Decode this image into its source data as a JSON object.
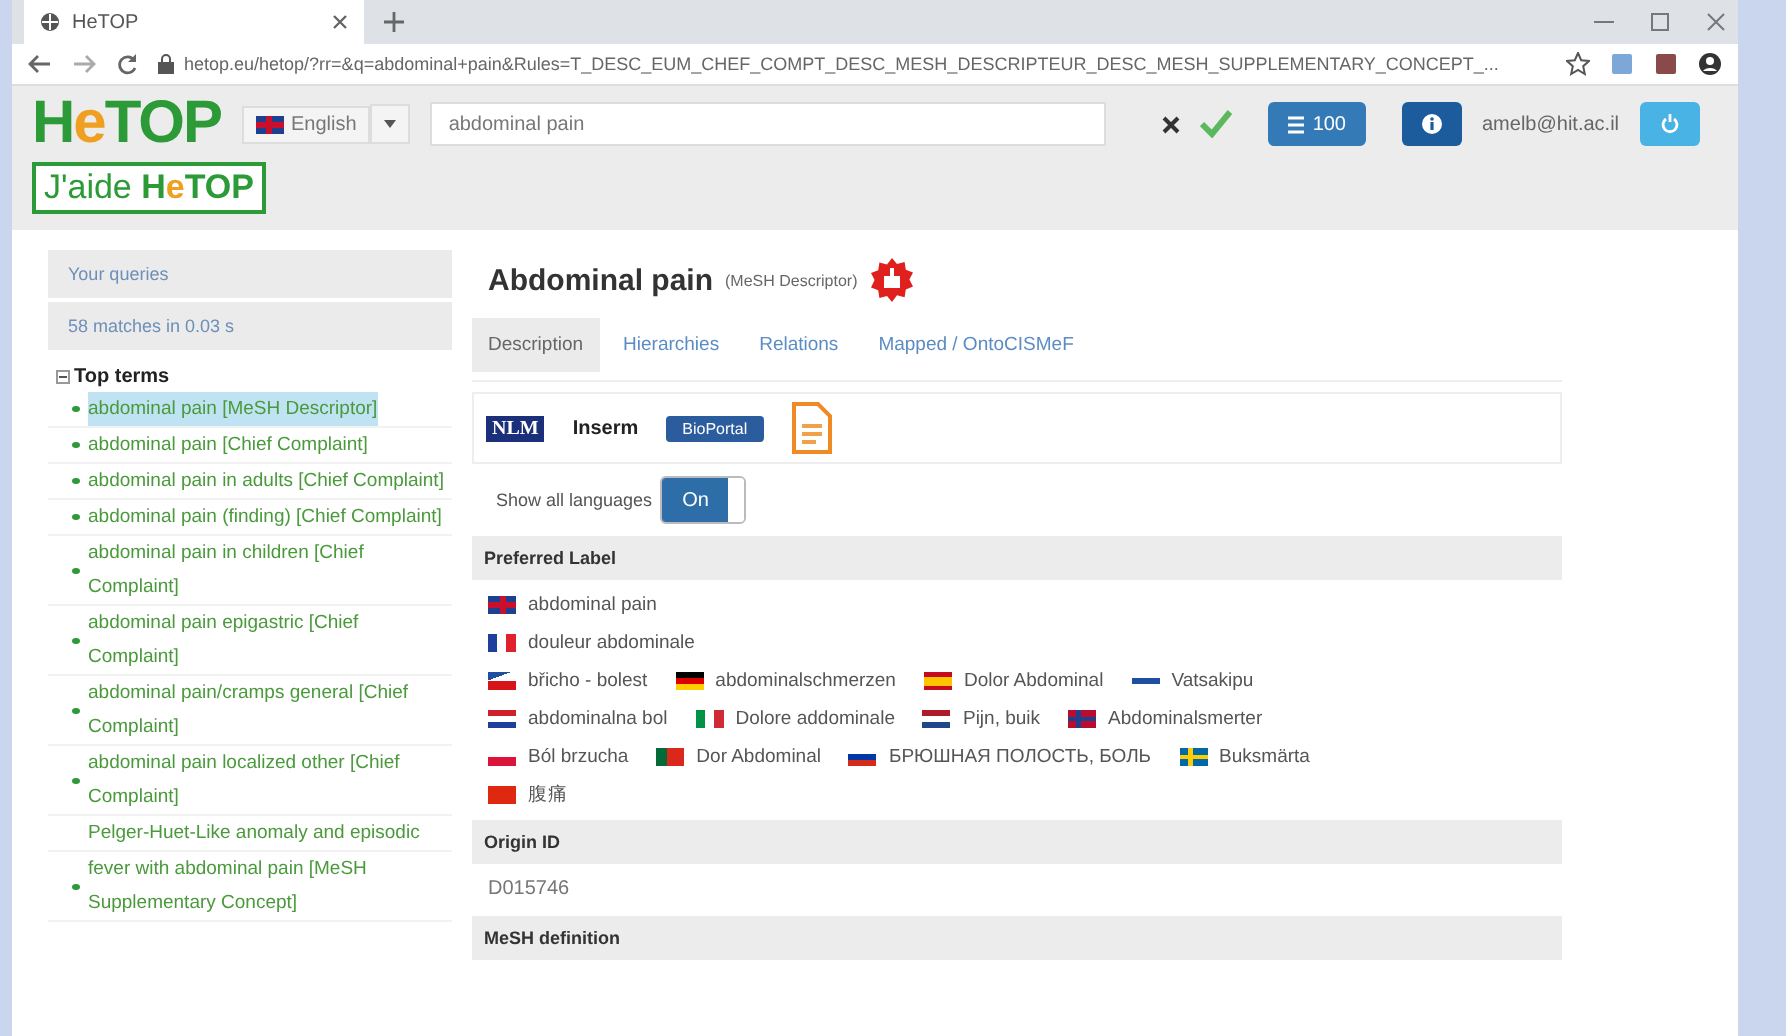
{
  "browser": {
    "tab_title": "HeTOP",
    "url": "hetop.eu/hetop/?rr=&q=abdominal+pain&Rules=T_DESC_EUM_CHEF_COMPT_DESC_MESH_DESCRIPTEUR_DESC_MESH_SUPPLEMENTARY_CONCEPT_..."
  },
  "header": {
    "logo": [
      {
        "text": "H",
        "accent": false
      },
      {
        "text": "e",
        "accent": true
      },
      {
        "text": "TOP",
        "accent": false
      }
    ],
    "language": "English",
    "search_value": "abdominal pain",
    "count_button": "100",
    "user": "amelb@hit.ac.il",
    "help_button": [
      {
        "text": "J'aide ",
        "accent": false
      },
      {
        "text": "H",
        "accent": false
      },
      {
        "text": "e",
        "accent": true
      },
      {
        "text": "TOP",
        "accent": false
      }
    ]
  },
  "sidebar": {
    "queries": "Your queries",
    "matches": "58 matches in 0.03 s",
    "tree": {
      "label": "Top terms",
      "expanded": true,
      "children": [
        {
          "label": "abdominal pain [MeSH Descriptor]",
          "selected": true,
          "bullet": true
        },
        {
          "label": "abdominal pain [Chief Complaint]",
          "selected": false,
          "bullet": true
        },
        {
          "label": "abdominal pain in adults [Chief Complaint]",
          "selected": false,
          "bullet": true
        },
        {
          "label": "abdominal pain (finding) [Chief Complaint]",
          "selected": false,
          "bullet": true
        },
        {
          "label": "abdominal pain in children [Chief Complaint]",
          "selected": false,
          "bullet": true
        },
        {
          "label": "abdominal pain epigastric [Chief Complaint]",
          "selected": false,
          "bullet": true
        },
        {
          "label": "abdominal pain/cramps general [Chief Complaint]",
          "selected": false,
          "bullet": true
        },
        {
          "label": "abdominal pain localized other [Chief Complaint]",
          "selected": false,
          "bullet": true
        },
        {
          "label": "Pelger-Huet-Like anomaly and episodic",
          "selected": false,
          "bullet": false
        },
        {
          "label": "fever with abdominal pain [MeSH Supplementary Concept]",
          "selected": false,
          "bullet": true
        }
      ]
    }
  },
  "main": {
    "title": "Abdominal pain",
    "subtitle": "(MeSH Descriptor)",
    "tabs": [
      {
        "label": "Description",
        "selected": true
      },
      {
        "label": "Hierarchies",
        "selected": false
      },
      {
        "label": "Relations",
        "selected": false
      },
      {
        "label": "Mapped / OntoCISMeF",
        "selected": false
      }
    ],
    "sources": [
      {
        "kind": "nlm",
        "label": "NLM"
      },
      {
        "kind": "inserm",
        "label": "Inserm"
      },
      {
        "kind": "bioportal",
        "label": "BioPortal"
      },
      {
        "kind": "file"
      }
    ],
    "languages_toggle": {
      "label": "Show all languages",
      "state": "On",
      "on": true
    },
    "sections": [
      {
        "title": "Preferred Label",
        "lines": [
          [
            {
              "kind": "en",
              "text": "abdominal pain"
            }
          ],
          [
            {
              "kind": "fr",
              "text": "douleur abdominale"
            }
          ],
          [
            {
              "kind": "cs",
              "text": "břicho - bolest"
            },
            {
              "kind": "de",
              "text": "abdominalschmerzen"
            },
            {
              "kind": "es",
              "text": "Dolor Abdominal"
            },
            {
              "kind": "fi",
              "text": "Vatsakipu"
            }
          ],
          [
            {
              "kind": "hr",
              "text": "abdominalna bol"
            },
            {
              "kind": "it",
              "text": "Dolore addominale"
            },
            {
              "kind": "nl",
              "text": "Pijn, buik"
            },
            {
              "kind": "no",
              "text": "Abdominalsmerter"
            }
          ],
          [
            {
              "kind": "pl",
              "text": "Ból brzucha"
            },
            {
              "kind": "pt",
              "text": "Dor Abdominal"
            },
            {
              "kind": "ru",
              "text": "БРЮШНАЯ ПОЛОСТЬ, БОЛЬ"
            },
            {
              "kind": "sv",
              "text": "Buksmärta"
            }
          ],
          [
            {
              "kind": "zh",
              "text": "腹痛"
            }
          ]
        ]
      },
      {
        "title": "Origin ID",
        "value": "D015746"
      },
      {
        "title": "MeSH definition"
      }
    ]
  }
}
